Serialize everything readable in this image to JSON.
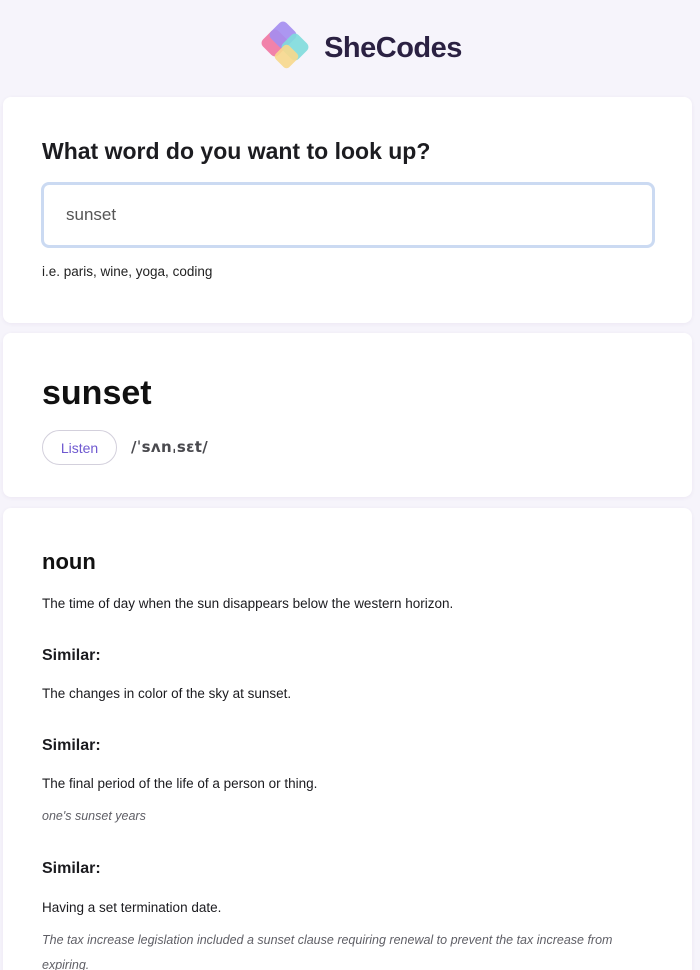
{
  "brand": {
    "name": "SheCodes",
    "colors": {
      "purple": "#a48df0",
      "pink": "#f07ba5",
      "teal": "#7fdcdc",
      "yellow": "#f7d88c",
      "text": "#2b2142"
    }
  },
  "search": {
    "title": "What word do you want to look up?",
    "value": "sunset",
    "hint": "i.e. paris, wine, yoga, coding"
  },
  "word": {
    "title": "sunset",
    "listen_label": "Listen",
    "phonetic": "/ˈsʌnˌsɛt/"
  },
  "meaning": {
    "part_of_speech": "noun",
    "definitions": [
      {
        "definition": "The time of day when the sun disappears below the western horizon.",
        "heading": "Similar:"
      },
      {
        "definition": "The changes in color of the sky at sunset.",
        "heading": "Similar:"
      },
      {
        "definition": "The final period of the life of a person or thing.",
        "example": "one's sunset years",
        "heading": "Similar:"
      },
      {
        "definition": "Having a set termination date.",
        "example": "The tax increase legislation included a sunset clause requiring renewal to prevent the tax increase from expiring."
      }
    ]
  }
}
